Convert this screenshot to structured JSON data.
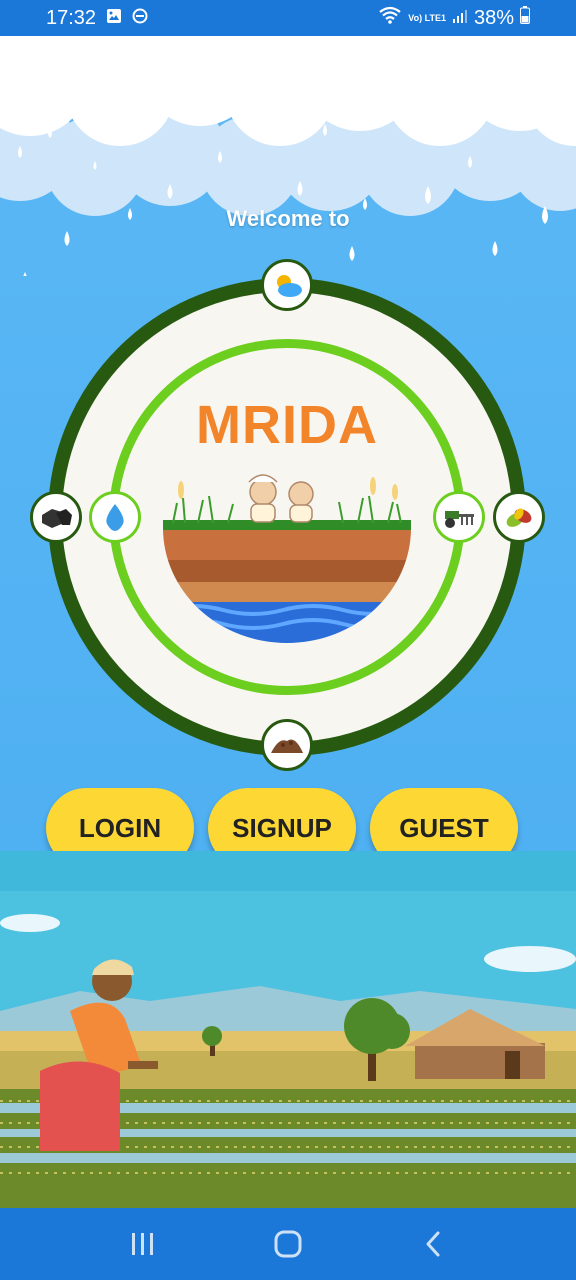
{
  "status_bar": {
    "time": "17:32",
    "network": "Vo) LTE1",
    "battery": "38%"
  },
  "welcome_text": "Welcome to",
  "brand": {
    "name": "MRIDA",
    "color": "#f28429"
  },
  "ring_icons": [
    {
      "name": "weather-icon"
    },
    {
      "name": "coal-icon"
    },
    {
      "name": "water-drop-icon"
    },
    {
      "name": "tractor-icon"
    },
    {
      "name": "leaves-icon"
    },
    {
      "name": "soil-icon"
    }
  ],
  "actions": {
    "login": "LOGIN",
    "signup": "SIGNUP",
    "guest": "GUEST"
  },
  "nav": {
    "recents": "recents-icon",
    "home": "home-icon",
    "back": "back-icon"
  },
  "colors": {
    "status_bar": "#1b78d8",
    "sky": "#55b4f3",
    "outer_ring": "#275a10",
    "inner_ring": "#6ccf20",
    "button": "#fdd835"
  }
}
